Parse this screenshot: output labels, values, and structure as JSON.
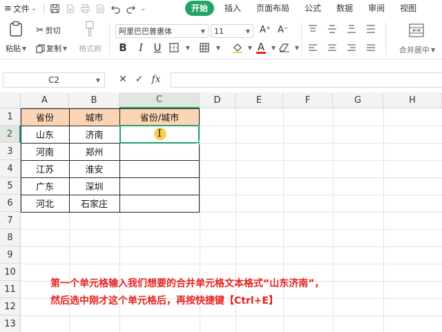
{
  "menubar": {
    "hamburger": "≡",
    "file": "文件",
    "caret": "⌄",
    "tabs": [
      "开始",
      "插入",
      "页面布局",
      "公式",
      "数据",
      "审阅",
      "视图"
    ]
  },
  "ribbon": {
    "paste": "粘贴",
    "cut": "剪切",
    "copy": "复制",
    "format_painter": "格式刷",
    "font_name": "阿里巴巴普惠体",
    "font_size": "11",
    "grow": "A⁺",
    "shrink": "A⁻",
    "bold": "B",
    "italic": "I",
    "underline": "U",
    "font_color_letter": "A",
    "merge_center": "合并居中",
    "accent_color": "#21a366",
    "font_color": "#e8221e"
  },
  "formula_bar": {
    "cell_ref": "C2",
    "cancel": "✕",
    "confirm": "✓",
    "fx": "fx",
    "value": ""
  },
  "sheet": {
    "columns": [
      "A",
      "B",
      "C",
      "D",
      "E",
      "F",
      "G",
      "H"
    ],
    "rows": [
      "1",
      "2",
      "3",
      "4",
      "5",
      "6",
      "7",
      "8",
      "9",
      "10",
      "11",
      "12",
      "13"
    ],
    "active_cell": "C2",
    "header": [
      "省份",
      "城市",
      "省份/城市"
    ],
    "data": [
      [
        "山东",
        "济南",
        ""
      ],
      [
        "河南",
        "郑州",
        ""
      ],
      [
        "江苏",
        "淮安",
        ""
      ],
      [
        "广东",
        "深圳",
        ""
      ],
      [
        "河北",
        "石家庄",
        ""
      ]
    ],
    "header_fill": "#fbd5b5"
  },
  "caption": {
    "line1": "第一个单元格输入我们想要的合并单元格文本格式“山东济南”，",
    "line2": "然后选中刚才这个单元格后，再按快捷键【Ctrl+E】"
  }
}
